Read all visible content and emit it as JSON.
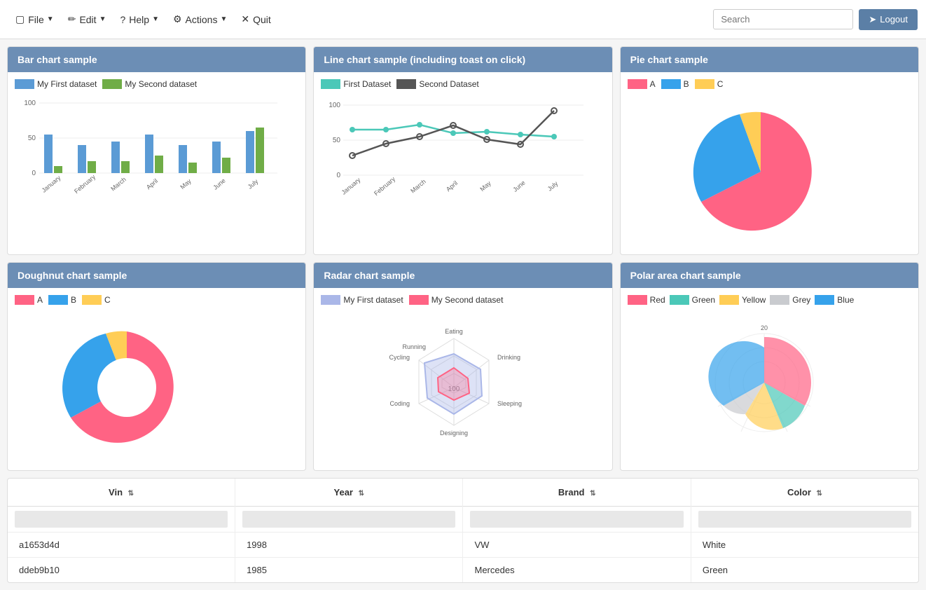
{
  "navbar": {
    "file_label": "File",
    "edit_label": "Edit",
    "help_label": "Help",
    "actions_label": "Actions",
    "quit_label": "Quit",
    "search_placeholder": "Search",
    "logout_label": "Logout"
  },
  "charts": {
    "bar": {
      "title": "Bar chart sample",
      "legend": [
        {
          "label": "My First dataset",
          "color": "#5b9bd5"
        },
        {
          "label": "My Second dataset",
          "color": "#70ad47"
        }
      ]
    },
    "line": {
      "title": "Line chart sample (including toast on click)",
      "legend": [
        {
          "label": "First Dataset",
          "color": "#4bc8b8"
        },
        {
          "label": "Second Dataset",
          "color": "#555"
        }
      ]
    },
    "pie": {
      "title": "Pie chart sample",
      "legend": [
        {
          "label": "A",
          "color": "#ff6384"
        },
        {
          "label": "B",
          "color": "#36a2eb"
        },
        {
          "label": "C",
          "color": "#ffcd56"
        }
      ]
    },
    "doughnut": {
      "title": "Doughnut chart sample",
      "legend": [
        {
          "label": "A",
          "color": "#ff6384"
        },
        {
          "label": "B",
          "color": "#36a2eb"
        },
        {
          "label": "C",
          "color": "#ffcd56"
        }
      ]
    },
    "radar": {
      "title": "Radar chart sample",
      "legend": [
        {
          "label": "My First dataset",
          "color": "#aab7e8"
        },
        {
          "label": "My Second dataset",
          "color": "#ff6384"
        }
      ]
    },
    "polar": {
      "title": "Polar area chart sample",
      "legend": [
        {
          "label": "Red",
          "color": "#ff6384"
        },
        {
          "label": "Green",
          "color": "#4bc8b8"
        },
        {
          "label": "Yellow",
          "color": "#ffcd56"
        },
        {
          "label": "Grey",
          "color": "#c9cbcf"
        },
        {
          "label": "Blue",
          "color": "#36a2eb"
        }
      ]
    }
  },
  "table": {
    "columns": [
      {
        "label": "Vin",
        "key": "vin"
      },
      {
        "label": "Year",
        "key": "year"
      },
      {
        "label": "Brand",
        "key": "brand"
      },
      {
        "label": "Color",
        "key": "color"
      }
    ],
    "rows": [
      {
        "vin": "a1653d4d",
        "year": "1998",
        "brand": "VW",
        "color": "White"
      },
      {
        "vin": "ddeb9b10",
        "year": "1985",
        "brand": "Mercedes",
        "color": "Green"
      }
    ]
  }
}
